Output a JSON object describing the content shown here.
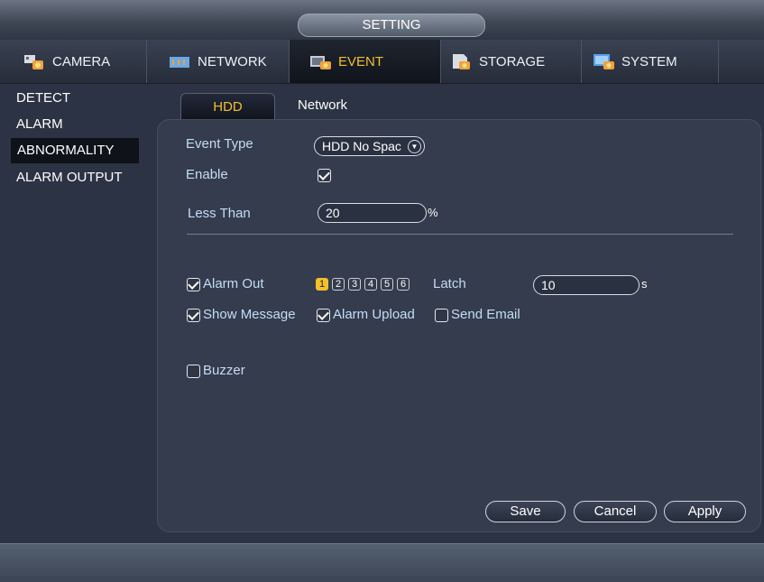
{
  "window": {
    "title": "SETTING"
  },
  "tabs": [
    {
      "label": "CAMERA",
      "icon": "camera-icon"
    },
    {
      "label": "NETWORK",
      "icon": "network-icon"
    },
    {
      "label": "EVENT",
      "icon": "event-icon",
      "active": true
    },
    {
      "label": "STORAGE",
      "icon": "storage-icon"
    },
    {
      "label": "SYSTEM",
      "icon": "system-icon"
    }
  ],
  "sidebar": {
    "items": [
      {
        "label": "DETECT"
      },
      {
        "label": "ALARM"
      },
      {
        "label": "ABNORMALITY",
        "selected": true
      },
      {
        "label": "ALARM OUTPUT"
      }
    ]
  },
  "subtabs": {
    "hdd": "HDD",
    "network": "Network"
  },
  "form": {
    "event_type_label": "Event Type",
    "event_type_value": "HDD No Spac",
    "enable_label": "Enable",
    "enable_checked": true,
    "less_than_label": "Less Than",
    "less_than_value": "20",
    "less_than_unit": "%",
    "alarm_out_label": "Alarm Out",
    "alarm_out_checked": true,
    "alarm_out_channels": [
      "1",
      "2",
      "3",
      "4",
      "5",
      "6"
    ],
    "alarm_out_selected": "1",
    "latch_label": "Latch",
    "latch_value": "10",
    "latch_unit": "s",
    "show_message_label": "Show Message",
    "show_message_checked": true,
    "alarm_upload_label": "Alarm Upload",
    "alarm_upload_checked": true,
    "send_email_label": "Send Email",
    "send_email_checked": false,
    "buzzer_label": "Buzzer",
    "buzzer_checked": false
  },
  "buttons": {
    "save": "Save",
    "cancel": "Cancel",
    "apply": "Apply"
  },
  "colors": {
    "accent": "#f3c02a",
    "label_blue": "#c5dcf8",
    "background": "#2c3344"
  }
}
